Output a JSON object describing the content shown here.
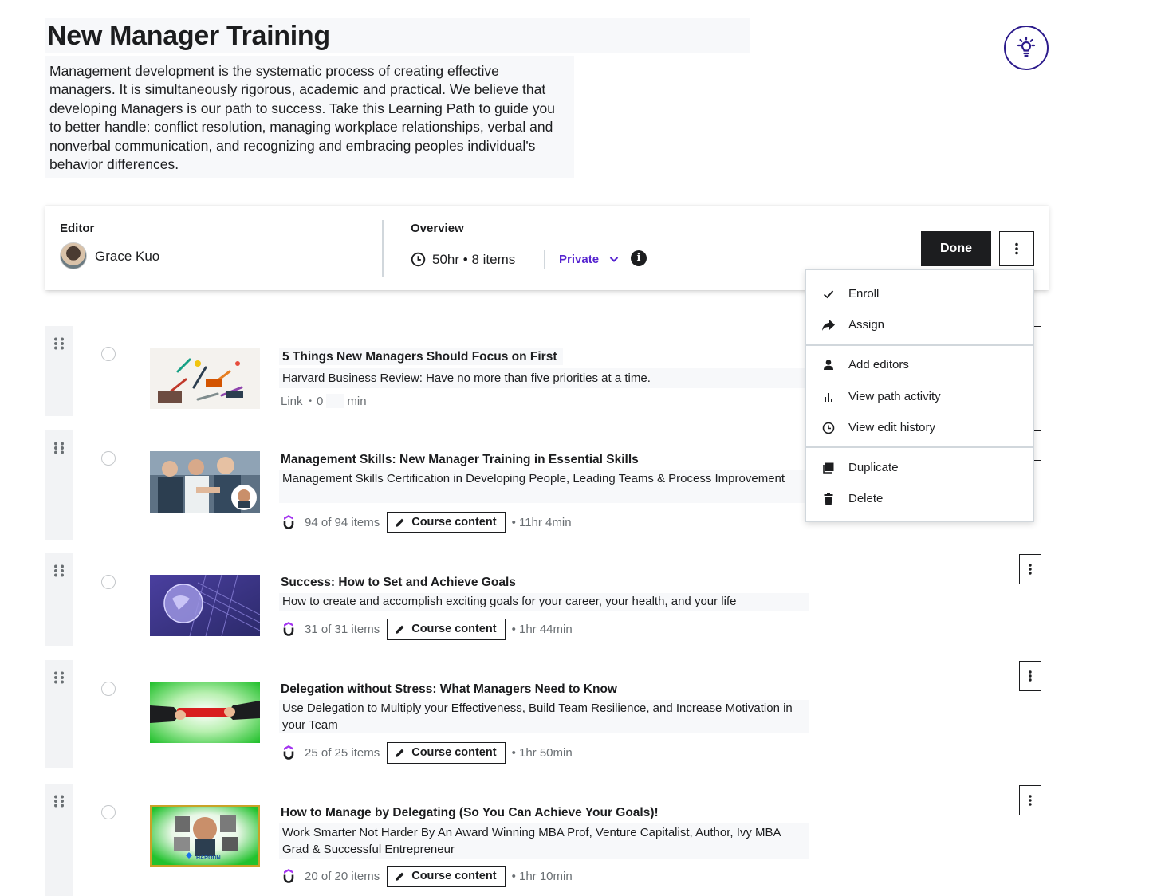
{
  "page": {
    "title": "New Manager Training",
    "description": "Management development is the systematic process of creating effective managers. It is simultaneously rigorous, academic and practical. We believe that developing Managers is our path to success. Take this Learning Path to guide you to better handle: conflict resolution, managing workplace relationships, verbal and nonverbal communication, and recognizing and embracing peoples individual's behavior differences."
  },
  "icons": {
    "tips": "lightbulb-icon",
    "duration": "clock-icon",
    "info": "info-icon",
    "more": "kebab-icon",
    "drag": "drag-handle-icon",
    "edit": "pencil-icon",
    "provider": "udemy-logo-icon"
  },
  "colors": {
    "accent": "#5624d0",
    "tips_ring": "#2d1c8c",
    "done_bg": "#1c1d1f"
  },
  "card": {
    "editor_label": "Editor",
    "editor_name": "Grace Kuo",
    "overview_label": "Overview",
    "duration": "50hr",
    "bullet": "•",
    "items_count": "8 items",
    "visibility": "Private",
    "done_label": "Done"
  },
  "menu": {
    "items": [
      {
        "label": "Enroll",
        "icon": "check-icon"
      },
      {
        "label": "Assign",
        "icon": "share-arrow-icon"
      },
      {
        "label": "Add editors",
        "icon": "person-icon"
      },
      {
        "label": "View path activity",
        "icon": "bar-chart-icon"
      },
      {
        "label": "View edit history",
        "icon": "clock-icon"
      },
      {
        "label": "Duplicate",
        "icon": "copy-icon"
      },
      {
        "label": "Delete",
        "icon": "trash-icon"
      }
    ]
  },
  "items": [
    {
      "title": "5 Things New Managers Should Focus on First",
      "subtitle": "Harvard Business Review: Have no more than five priorities at a time.",
      "type": "Link",
      "sep": "•",
      "duration_value": "0",
      "duration_unit": "min"
    },
    {
      "title": "Management Skills: New Manager Training in Essential Skills",
      "subtitle": "Management Skills Certification in Developing People, Leading Teams & Process Improvement",
      "progress": "94 of 94 items",
      "course_btn": "Course content",
      "duration": "• 11hr 4min"
    },
    {
      "title": "Success: How to Set and Achieve Goals",
      "subtitle": "How to create and accomplish exciting goals for your career, your health, and your life",
      "progress": "31 of 31 items",
      "course_btn": "Course content",
      "duration": "• 1hr 44min"
    },
    {
      "title": "Delegation without Stress: What Managers Need to Know",
      "subtitle": "Use Delegation to Multiply your Effectiveness, Build Team Resilience, and Increase Motivation in your Team",
      "progress": "25 of 25 items",
      "course_btn": "Course content",
      "duration": "• 1hr 50min"
    },
    {
      "title": "How to Manage by Delegating (So You Can Achieve Your Goals)!",
      "subtitle": "Work Smarter Not Harder By An Award Winning MBA Prof, Venture Capitalist, Author, Ivy MBA Grad & Successful Entrepreneur",
      "progress": "20 of 20 items",
      "course_btn": "Course content",
      "duration": "• 1hr 10min",
      "thumb_text": "HAROUN"
    }
  ]
}
